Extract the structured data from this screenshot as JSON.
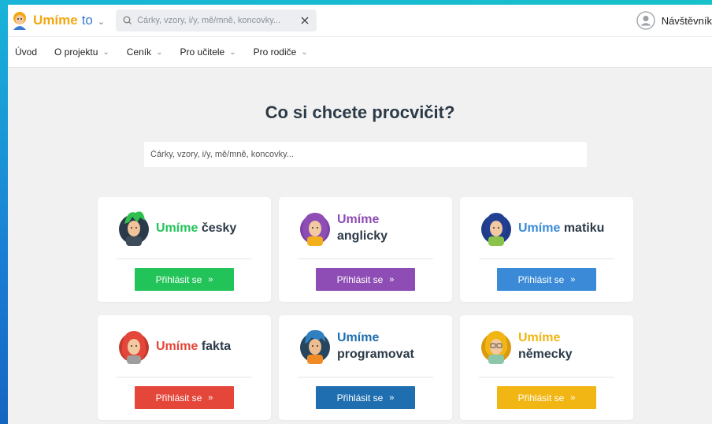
{
  "brand": {
    "name": "Umíme",
    "suffix": "to"
  },
  "top_search": {
    "placeholder": "Čárky, vzory, i/y, mě/mně, koncovky..."
  },
  "user": {
    "name": "Návštěvník"
  },
  "nav": [
    {
      "label": "Úvod",
      "dropdown": false
    },
    {
      "label": "O projektu",
      "dropdown": true
    },
    {
      "label": "Ceník",
      "dropdown": true
    },
    {
      "label": "Pro učitele",
      "dropdown": true
    },
    {
      "label": "Pro rodiče",
      "dropdown": true
    }
  ],
  "main": {
    "heading": "Co si chcete procvičit?",
    "search_placeholder": "Čárky, vzory, i/y, mě/mně, koncovky..."
  },
  "cards": [
    {
      "brand": "Umíme",
      "subject": "česky",
      "color": "#22c45a",
      "button": "Přihlásit se",
      "icon": "green-hair-avatar-icon"
    },
    {
      "brand": "Umíme",
      "subject": "anglicky",
      "color": "#8e4db5",
      "button": "Přihlásit se",
      "icon": "purple-hair-avatar-icon"
    },
    {
      "brand": "Umíme",
      "subject": "matiku",
      "color": "#3a8ad8",
      "button": "Přihlásit se",
      "icon": "blue-hair-avatar-icon"
    },
    {
      "brand": "Umíme",
      "subject": "fakta",
      "color": "#e4463a",
      "button": "Přihlásit se",
      "icon": "red-hair-avatar-icon"
    },
    {
      "brand": "Umíme",
      "subject": "programovat",
      "color": "#1f6fb0",
      "button": "Přihlásit se",
      "icon": "blue-hair-boy-avatar-icon"
    },
    {
      "brand": "Umíme",
      "subject": "německy",
      "color": "#f1b514",
      "button": "Přihlásit se",
      "icon": "blonde-glasses-avatar-icon"
    }
  ],
  "button_arrow": "»",
  "chevron": "⌄"
}
